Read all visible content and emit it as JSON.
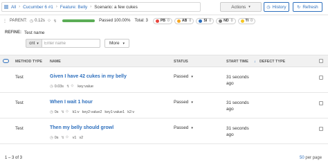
{
  "breadcrumb": {
    "all": "All",
    "launch": "Cucumber 6 #1",
    "feature": "Feature: Belly",
    "scenario": "Scenario: a few cukes"
  },
  "toolbar": {
    "actions": "Actions",
    "history": "History",
    "refresh": "Refresh"
  },
  "info": {
    "parent": "PARENT:",
    "duration": "0.12s",
    "passed": "Passed 100.00%",
    "total": "Total: 3",
    "progress_fraction": 1.0,
    "badges": [
      {
        "code": "PB",
        "count": "0",
        "color": "#e8453c"
      },
      {
        "code": "AB",
        "count": "0",
        "color": "#f5a623"
      },
      {
        "code": "SI",
        "count": "0",
        "color": "#2d6fbd"
      },
      {
        "code": "ND",
        "count": "0",
        "color": "#777777"
      },
      {
        "code": "TI",
        "count": "0",
        "color": "#f5c623"
      }
    ]
  },
  "refine": {
    "label": "REFINE:",
    "field": "Test name",
    "condition": "cnt",
    "placeholder": "Enter name",
    "more": "More"
  },
  "table": {
    "headers": {
      "method_type": "METHOD TYPE",
      "name": "NAME",
      "status": "STATUS",
      "start_time": "START TIME",
      "defect_type": "DEFECT TYPE"
    },
    "rows": [
      {
        "method": "Test",
        "name": "Given I have 42 cukes in my belly",
        "duration": "0.03s",
        "attributes": [
          "key:value"
        ],
        "status": "Passed",
        "start": "31 seconds ago"
      },
      {
        "method": "Test",
        "name": "When I wait 1 hour",
        "duration": "0s",
        "attributes": [
          "k1:v",
          "key2:value2",
          "key1:value1",
          "k2:v"
        ],
        "status": "Passed",
        "start": "31 seconds ago"
      },
      {
        "method": "Test",
        "name": "Then my belly should growl",
        "duration": "0s",
        "attributes": [
          "v1",
          "v2"
        ],
        "status": "Passed",
        "start": "31 seconds ago"
      }
    ]
  },
  "footer": {
    "range": "1 – 3 of 3",
    "page_size": "50",
    "per_page": "per page"
  },
  "colors": {
    "accent": "#2d6fbd",
    "passed": "#5bad56"
  }
}
